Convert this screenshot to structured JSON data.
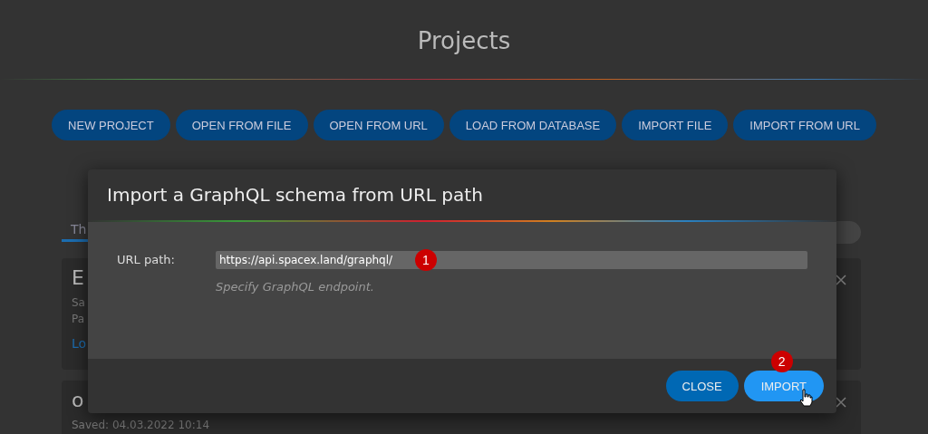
{
  "page": {
    "title": "Projects"
  },
  "toolbar": [
    "NEW PROJECT",
    "OPEN FROM FILE",
    "OPEN FROM URL",
    "LOAD FROM DATABASE",
    "IMPORT FILE",
    "IMPORT FROM URL"
  ],
  "background": {
    "tab": "Th",
    "cards": [
      {
        "title": "E",
        "lines": [
          "Sa",
          "Pa"
        ],
        "link": "Lo"
      },
      {
        "title": "o",
        "lines": [
          "Saved: 04.03.2022 10:14"
        ]
      }
    ]
  },
  "dialog": {
    "title": "Import a GraphQL schema from URL path",
    "field": {
      "label": "URL path:",
      "value": "https://api.spacex.land/graphql/",
      "hint": "Specify GraphQL endpoint.",
      "marker": "1"
    },
    "buttons": [
      {
        "label": "CLOSE",
        "kind": "secondary"
      },
      {
        "label": "IMPORT",
        "kind": "primary",
        "marker": "2"
      }
    ]
  }
}
